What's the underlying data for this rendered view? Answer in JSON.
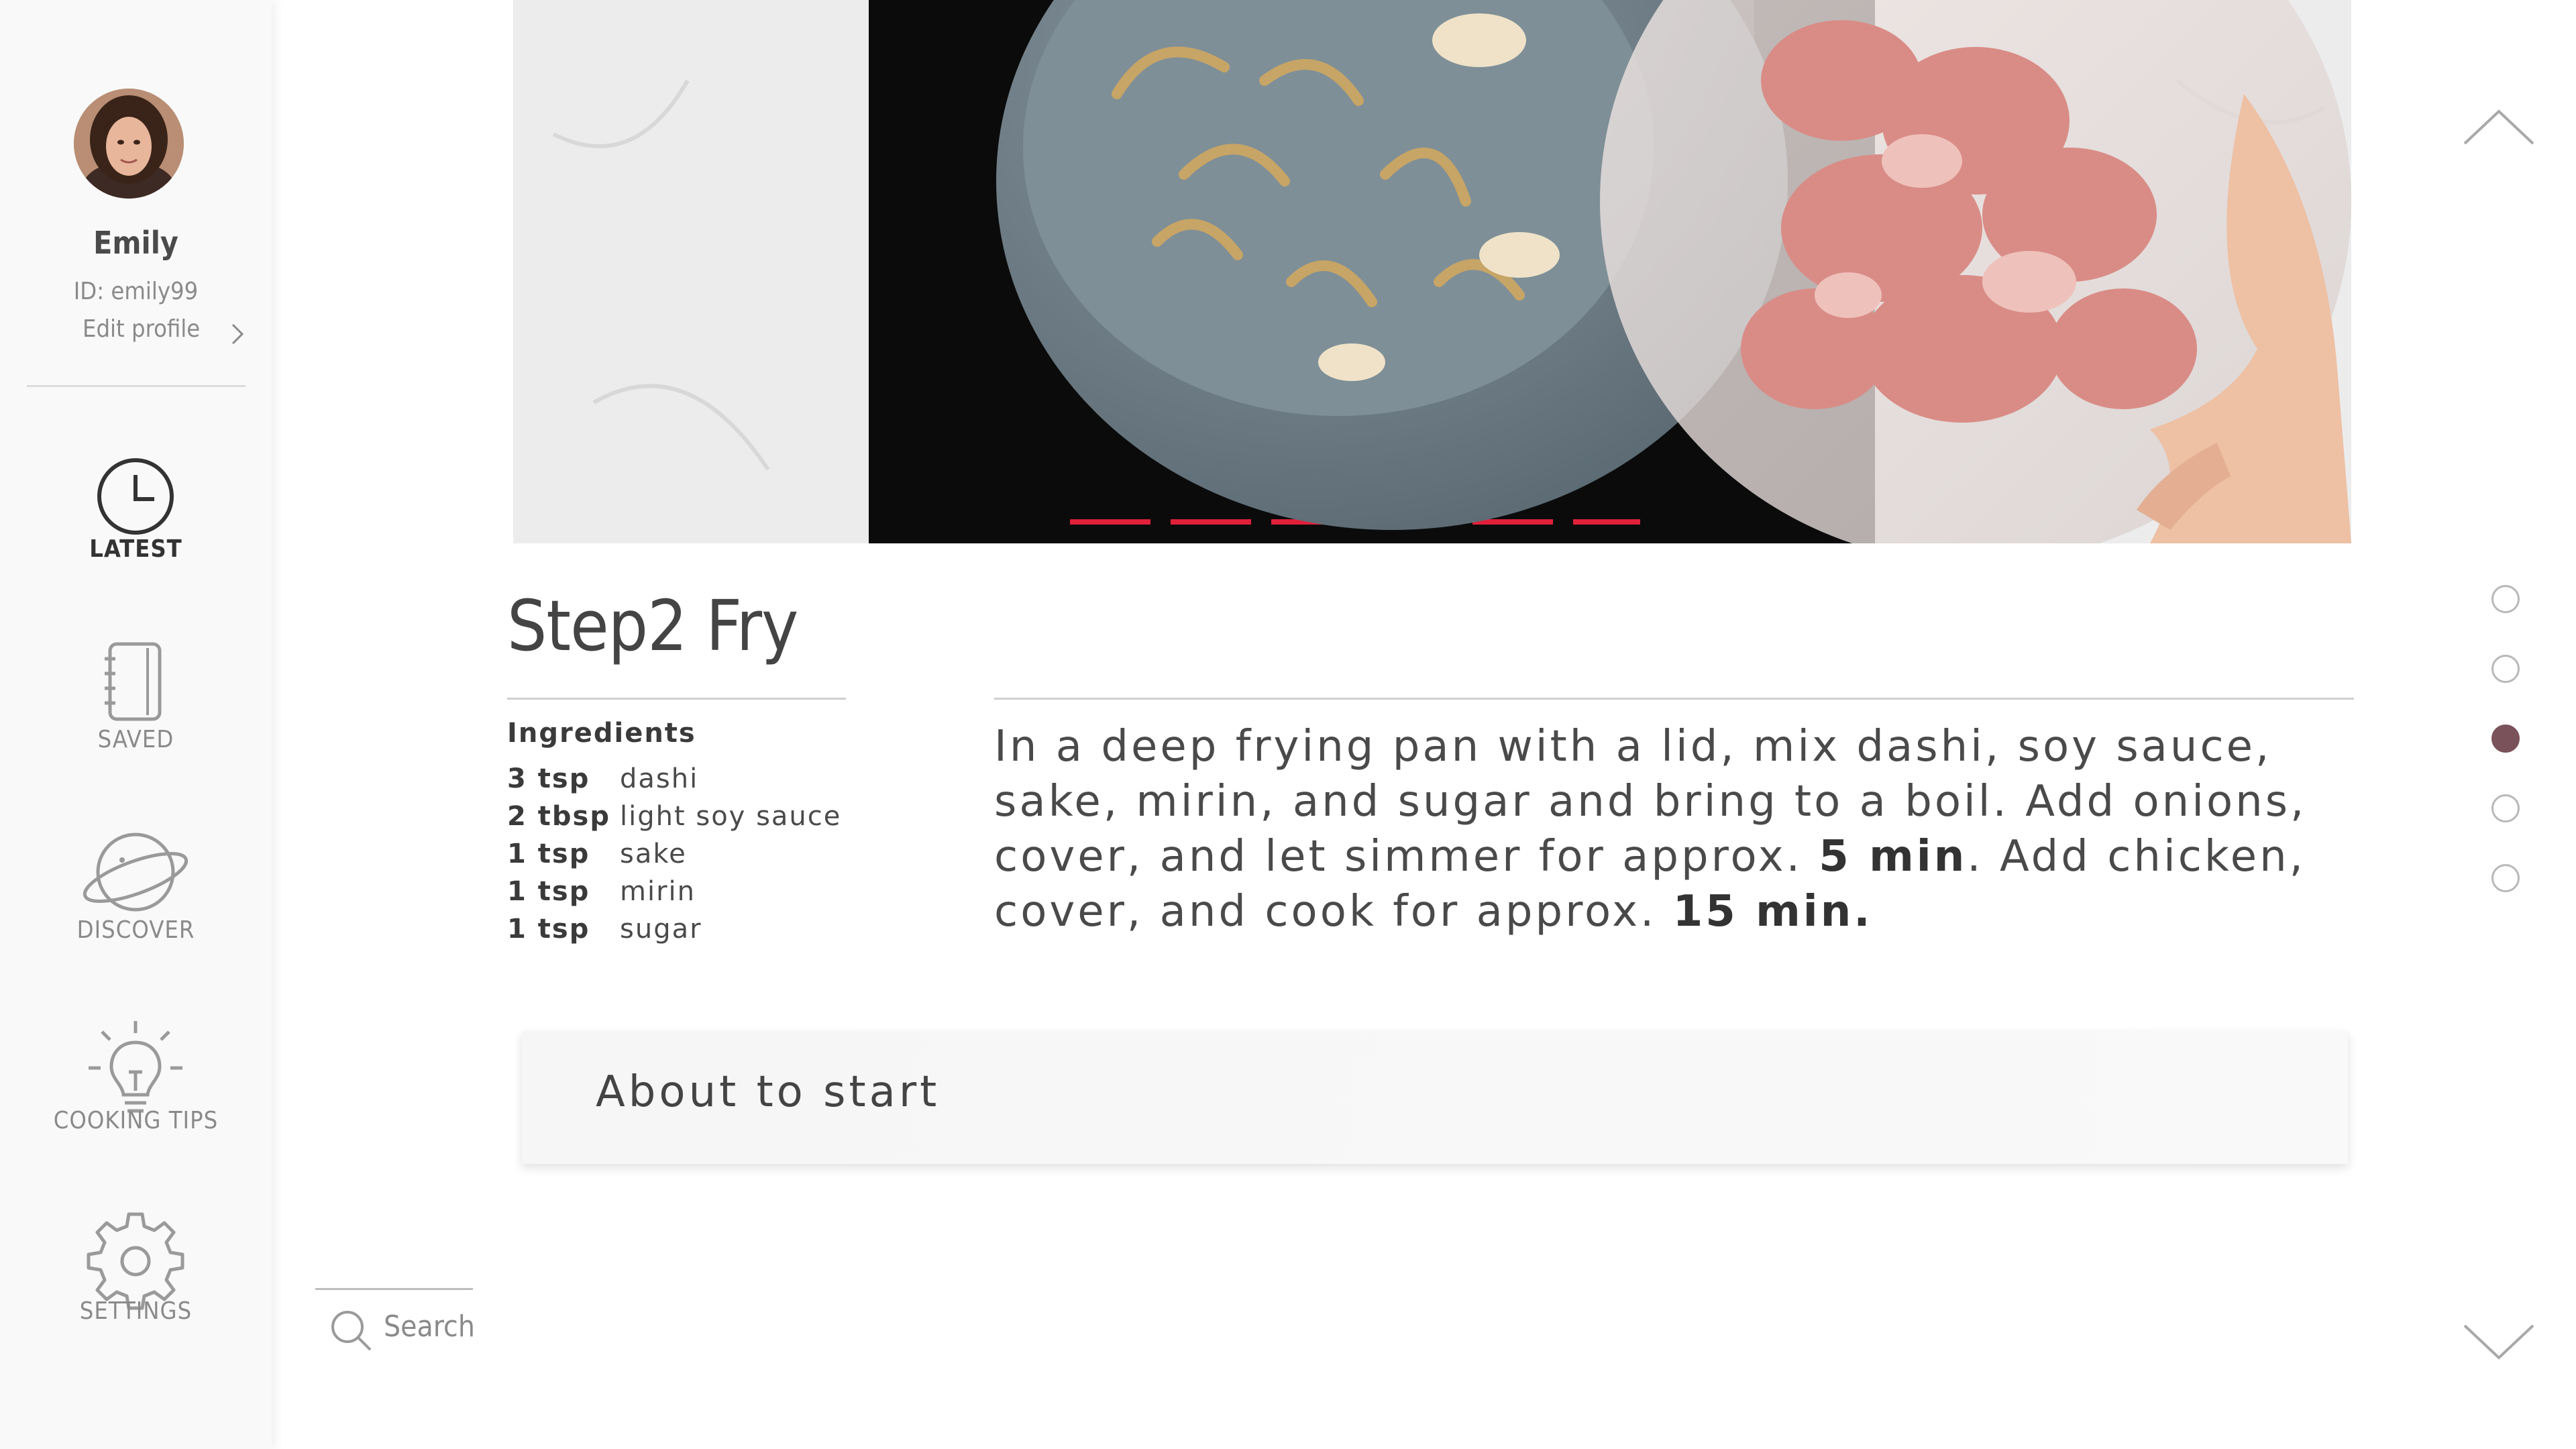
{
  "profile": {
    "name": "Emily",
    "id_text": "ID: emily99",
    "edit_label": "Edit profile"
  },
  "nav": [
    {
      "label": "LATEST",
      "icon": "clock-icon",
      "active": true
    },
    {
      "label": "SAVED",
      "icon": "notebook-icon",
      "active": false
    },
    {
      "label": "DISCOVER",
      "icon": "planet-icon",
      "active": false
    },
    {
      "label": "COOKING TIPS",
      "icon": "lightbulb-icon",
      "active": false
    },
    {
      "label": "SETTINGS",
      "icon": "gear-icon",
      "active": false
    }
  ],
  "search": {
    "label": "Search",
    "icon": "search-icon"
  },
  "step": {
    "title": "Step2 Fry",
    "ingredients_heading": "Ingredients",
    "ingredients": [
      {
        "qty": "3 tsp",
        "name": "dashi"
      },
      {
        "qty": "2 tbsp",
        "name": "light soy sauce"
      },
      {
        "qty": "1 tsp",
        "name": "sake"
      },
      {
        "qty": "1 tsp",
        "name": "mirin"
      },
      {
        "qty": "1 tsp",
        "name": "sugar"
      }
    ],
    "instructions": {
      "part1": "In a deep frying pan with a lid, mix dashi, soy sauce, sake, mirin, and sugar and bring to a boil. Add onions, cover, and let simmer for approx. ",
      "time1": "5 min",
      "part2": ". Add chicken, cover, and cook for approx. ",
      "time2": "15 min."
    }
  },
  "status": {
    "label": "About to start"
  },
  "pager": {
    "total": 5,
    "active_index": 2
  },
  "colors": {
    "accent": "#7a5259",
    "sidebar_bg": "#f9f9f9"
  }
}
